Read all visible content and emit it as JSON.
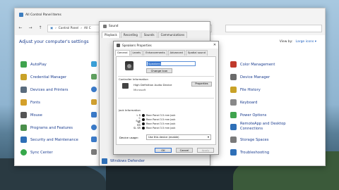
{
  "control_panel": {
    "title": "All Control Panel Items",
    "address": [
      "Control Panel",
      "All C"
    ],
    "heading": "Adjust your computer's settings",
    "view_by_label": "View by:",
    "view_by_value": "Large icons ▾",
    "items_left": [
      {
        "label": "AutoPlay",
        "color": "#3fa34d"
      },
      {
        "label": "Credential Manager",
        "color": "#c9a227"
      },
      {
        "label": "Devices and Printers",
        "color": "#5a6c7d"
      },
      {
        "label": "Fonts",
        "color": "#d4a02a"
      },
      {
        "label": "Mouse",
        "color": "#555"
      },
      {
        "label": "Programs and Features",
        "color": "#4a8f4a"
      },
      {
        "label": "Security and Maintenance",
        "color": "#2e6fb7"
      },
      {
        "label": "Sync Center",
        "color": "#36a84a"
      }
    ],
    "items_right": [
      {
        "label": "Color Management",
        "color": "#c0392b"
      },
      {
        "label": "Device Manager",
        "color": "#6a6a6a"
      },
      {
        "label": "File History",
        "color": "#c9a227"
      },
      {
        "label": "Keyboard",
        "color": "#888"
      },
      {
        "label": "Power Options",
        "color": "#3fa34d"
      },
      {
        "label": "RemoteApp and Desktop Connections",
        "color": "#2e6fb7"
      },
      {
        "label": "Storage Spaces",
        "color": "#7a7a7a"
      },
      {
        "label": "Troubleshooting",
        "color": "#2e6fb7"
      }
    ]
  },
  "sound": {
    "title": "Sound",
    "tabs": [
      "Playback",
      "Recording",
      "Sounds",
      "Communications"
    ],
    "bottom_item": "Windows Defender"
  },
  "speakers": {
    "title": "Speakers Properties",
    "tabs": [
      "General",
      "Levels",
      "Enhancements",
      "Advanced",
      "Spatial sound"
    ],
    "name_value": "Speakers",
    "change_icon": "Change Icon",
    "controller_label": "Controller Information",
    "controller_name": "High Definition Audio Device",
    "controller_vendor": "Microsoft",
    "properties": "Properties",
    "jack_label": "Jack Information",
    "jacks": [
      {
        "ch": "L R",
        "desc": "Rear Panel 3.5 mm Jack"
      },
      {
        "ch": "C Sub",
        "desc": "Rear Panel 3.5 mm Jack"
      },
      {
        "ch": "RL RR",
        "desc": "Rear Panel 3.5 mm Jack"
      },
      {
        "ch": "SL SR",
        "desc": "Rear Panel 3.5 mm Jack"
      }
    ],
    "device_usage_label": "Device usage:",
    "device_usage_value": "Use this device (enable)",
    "ok": "OK",
    "cancel": "Cancel",
    "apply": "Apply"
  }
}
